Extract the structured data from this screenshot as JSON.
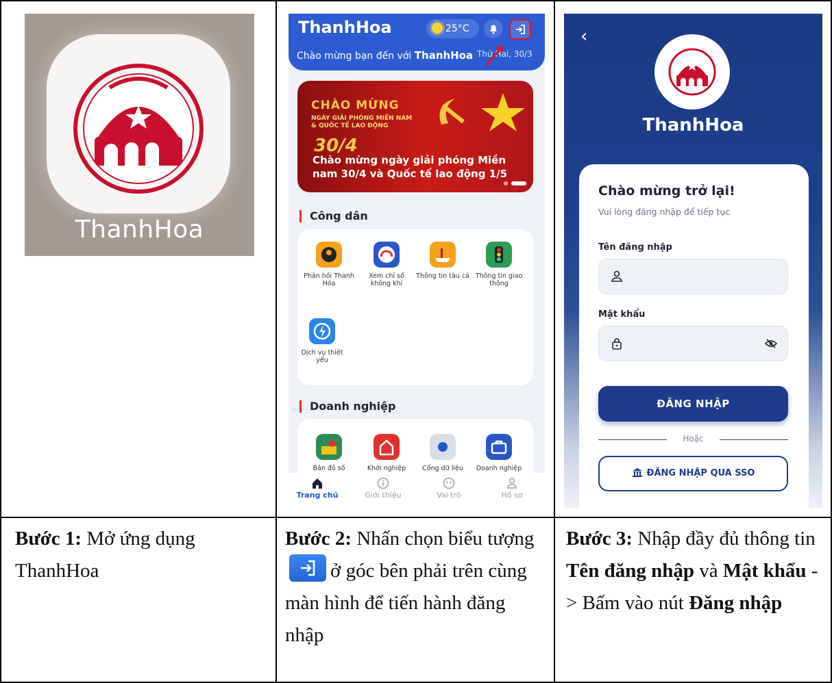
{
  "panel1": {
    "app_label": "ThanhHoa"
  },
  "panel2": {
    "brand": "ThanhHoa",
    "temperature": "25°C",
    "welcome_prefix": "Chào mừng bạn đến với ",
    "welcome_brand": "ThanhHoa",
    "date": "Thứ Hai, 30/3",
    "banner": {
      "title": "CHÀO MỪNG",
      "line1": "NGÀY GIẢI PHÓNG MIỀN NAM",
      "line2": "& QUỐC TẾ LAO ĐỘNG",
      "date_art": "30/4",
      "caption": "Chào mừng ngày giải phóng Miền nam 30/4 và Quốc tế lao động 1/5"
    },
    "section_citizen": "Công dân",
    "citizen_tiles": [
      {
        "label": "Phản hồi Thanh Hóa",
        "icon": "feedback-icon",
        "color": "#f2a21c"
      },
      {
        "label": "Xem chỉ số không khí",
        "icon": "air-quality-icon",
        "color": "#2a56c8"
      },
      {
        "label": "Thông tin tàu cá",
        "icon": "fishing-boat-icon",
        "color": "#f2a21c"
      },
      {
        "label": "Thông tin giao thông",
        "icon": "traffic-light-icon",
        "color": "#2e9b57"
      },
      {
        "label": "Dịch vụ thiết yếu",
        "icon": "essential-service-icon",
        "color": "#2b86e6"
      }
    ],
    "section_business": "Doanh nghiệp",
    "business_tiles": [
      {
        "label": "Bản đồ số",
        "icon": "map-icon",
        "color": "#2e8b57"
      },
      {
        "label": "Khởi nghiệp",
        "icon": "startup-icon",
        "color": "#e0322c"
      },
      {
        "label": "Cổng dữ liệu",
        "icon": "data-portal-icon",
        "color": "#d9dde6"
      },
      {
        "label": "Doanh nghiệp",
        "icon": "briefcase-icon",
        "color": "#2a56c8"
      }
    ],
    "nav": [
      {
        "label": "Trang chủ",
        "icon": "home-icon"
      },
      {
        "label": "Giới thiệu",
        "icon": "info-icon"
      },
      {
        "label": "Vai trò",
        "icon": "role-icon"
      },
      {
        "label": "Hồ sơ",
        "icon": "profile-icon"
      }
    ]
  },
  "panel3": {
    "title": "ThanhHoa",
    "heading": "Chào mừng trở lại!",
    "subheading": "Vui lòng đăng nhập để tiếp tục",
    "username_label": "Tên đăng nhập",
    "password_label": "Mật khẩu",
    "login_button": "ĐĂNG NHẬP",
    "or_text": "Hoặc",
    "sso_button": "ĐĂNG NHẬP QUA SSO"
  },
  "steps": {
    "s1_bold": "Bước 1:",
    "s1_text": " Mở ứng dụng ThanhHoa",
    "s2_bold": "Bước 2:",
    "s2_text_a": " Nhấn chọn biểu tượng",
    "s2_text_b": "ở góc bên phải trên cùng màn hình để tiến hành đăng nhập",
    "s3_bold": "Bước 3:",
    "s3_text_a": " Nhập đầy đủ thông tin ",
    "s3_bold_a": "Tên đăng nhập",
    "s3_text_b": " và ",
    "s3_bold_b": "Mật khẩu",
    "s3_text_c": " -> Bấm vào nút ",
    "s3_bold_c": "Đăng nhập"
  }
}
